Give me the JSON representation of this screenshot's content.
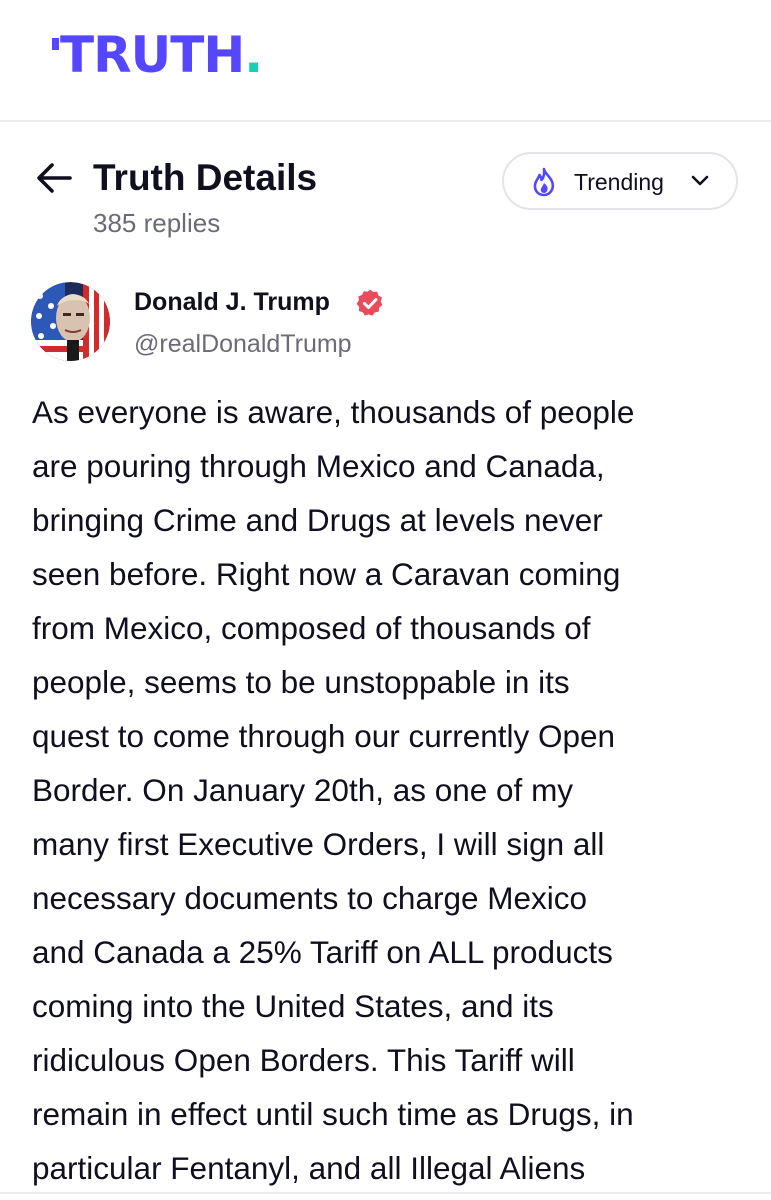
{
  "brand": {
    "logo_text": "TRUTH",
    "logo_dot": ".",
    "colors": {
      "logo": "#5447ff",
      "dot": "#16d1b2"
    }
  },
  "header": {
    "back_icon": "arrow-left-icon",
    "title": "Truth Details",
    "reply_count": "385 replies",
    "sort": {
      "icon": "fire-icon",
      "selected": "Trending",
      "chevron_icon": "chevron-down-icon"
    }
  },
  "post": {
    "author": {
      "name": "Donald J. Trump",
      "handle": "@realDonaldTrump",
      "verified_icon": "verified-badge-icon",
      "verified_color": "#e94c5b"
    },
    "body_lines": [
      "As everyone is aware, thousands of people",
      "are pouring through Mexico and Canada,",
      "bringing Crime and Drugs at levels never",
      "seen before. Right now a Caravan coming",
      "from Mexico, composed of thousands of",
      "people, seems to be unstoppable in its",
      "quest to come through our currently Open",
      "Border. On January 20th, as one of my",
      "many first Executive Orders, I will sign all",
      "necessary documents to charge Mexico",
      "and Canada a 25% Tariff on ALL products",
      "coming into the United States, and its",
      "ridiculous Open Borders. This Tariff will",
      "remain in effect until such time as Drugs, in",
      "particular Fentanyl, and all Illegal Aliens"
    ]
  },
  "colors": {
    "text_primary": "#0f0f1e",
    "text_secondary": "#6b6b78",
    "accent": "#5447ff"
  }
}
